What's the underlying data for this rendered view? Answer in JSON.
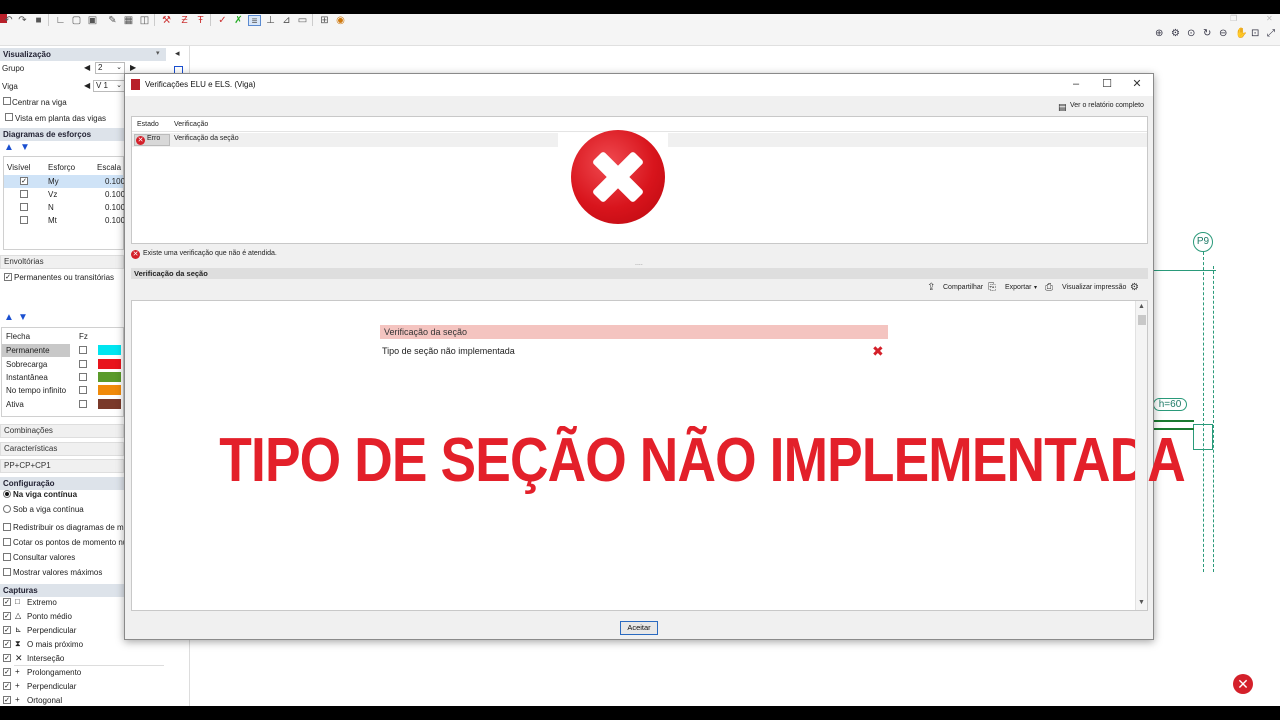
{
  "left_panel": {
    "visualizacao_header": "Visualização",
    "grupo_label": "Grupo",
    "grupo_value": "2",
    "viga_label": "Viga",
    "viga_value": "V 1",
    "centrar_na_viga": "Centrar na viga",
    "vista_planta": "Vista em planta das vigas",
    "diagramas_header": "Diagramas de esforços",
    "diag_columns": [
      "Visível",
      "Esforço",
      "Escala"
    ],
    "diag_rows": [
      {
        "name": "My",
        "scale": "0.100",
        "checked": true
      },
      {
        "name": "Vz",
        "scale": "0.100",
        "checked": false
      },
      {
        "name": "N",
        "scale": "0.100",
        "checked": false
      },
      {
        "name": "Mt",
        "scale": "0.100",
        "checked": false
      }
    ],
    "envoltorias": "Envoltórias",
    "permanentes": "Permanentes ou transitórias",
    "flecha_columns": [
      "Flecha",
      "Fz"
    ],
    "flecha_rows": [
      {
        "name": "Permanente",
        "color": "#00e5f0"
      },
      {
        "name": "Sobrecarga",
        "color": "#e8141c"
      },
      {
        "name": "Instantânea",
        "color": "#5a9a2a"
      },
      {
        "name": "No tempo infinito",
        "color": "#f08a0a"
      },
      {
        "name": "Ativa",
        "color": "#7a3a2a"
      }
    ],
    "combinacoes": "Combinações",
    "caracteristicas": "Características",
    "pp_cp": "PP+CP+CP1",
    "configuracao_header": "Configuração",
    "na_viga_continua": "Na viga contínua",
    "sob_a_viga": "Sob a viga contínua",
    "redistribuir": "Redistribuir os diagramas de momentos",
    "cotar": "Cotar os pontos de momento nulo",
    "consultar": "Consultar valores",
    "mostrar": "Mostrar valores máximos",
    "capturas_header": "Capturas",
    "capturas": [
      "Extremo",
      "Ponto médio",
      "Perpendicular",
      "O mais próximo",
      "Interseção",
      "Prolongamento",
      "Perpendicular",
      "Ortogonal"
    ]
  },
  "canvas": {
    "column_label": "P9",
    "height_label": "h=60"
  },
  "dialog": {
    "title": "Verificações ELU e ELS. (Viga)",
    "report_link": "Ver o relatório completo",
    "grid_col_estado": "Estado",
    "grid_col_verificacao": "Verificação",
    "row_estado": "Erro",
    "row_verificacao": "Verificação da seção",
    "status_message": "Existe uma verificação que não é atendida.",
    "section_title": "Verificação da seção",
    "share_label": "Compartilhar",
    "export_label": "Exportar",
    "print_label": "Visualizar impressão",
    "report_header": "Verificação da seção",
    "report_item": "Tipo de seção não implementada",
    "banner": "TIPO DE SEÇÃO NÃO IMPLEMENTADA",
    "accept_label": "Aceitar"
  }
}
